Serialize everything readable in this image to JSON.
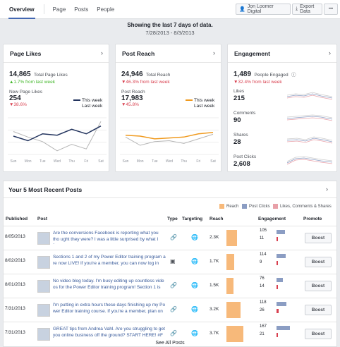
{
  "nav": {
    "tabs": [
      "Overview",
      "Page",
      "Posts",
      "People"
    ],
    "account": "Jon Loomer Digital",
    "export": "Export Data",
    "more": "•••"
  },
  "banner": {
    "line1": "Showing the last 7 days of data.",
    "line2": "7/28/2013 - 8/3/2013"
  },
  "page_likes": {
    "title": "Page Likes",
    "total": "14,865",
    "total_label": "Total Page Likes",
    "total_change": "▲1.7% from last week",
    "new_label": "New Page Likes",
    "new_value": "254",
    "new_change": "▼38.6%",
    "legend_this": "This week",
    "legend_last": "Last week",
    "days": [
      "Sun",
      "Mon",
      "Tue",
      "Wed",
      "Thu",
      "Fri",
      "Sat"
    ],
    "this_week": [
      40,
      30,
      45,
      42,
      55,
      45,
      62
    ],
    "last_week": [
      50,
      38,
      28,
      8,
      22,
      12,
      72
    ]
  },
  "post_reach": {
    "title": "Post Reach",
    "total": "24,946",
    "total_label": "Total Reach",
    "total_change": "▼46.3% from last week",
    "sub_label": "Post Reach",
    "sub_value": "17,983",
    "sub_change": "▼45.8%",
    "legend_this": "This week",
    "legend_last": "Last week",
    "days": [
      "Sun",
      "Mon",
      "Tue",
      "Wed",
      "Thu",
      "Fri",
      "Sat"
    ],
    "this_week": [
      42,
      40,
      34,
      36,
      38,
      45,
      48
    ],
    "last_week": [
      38,
      20,
      28,
      30,
      24,
      34,
      44
    ]
  },
  "engagement": {
    "title": "Engagement",
    "total": "1,489",
    "total_label": "People Engaged",
    "total_change": "▼32.4% from last week",
    "rows": [
      {
        "label": "Likes",
        "value": "215"
      },
      {
        "label": "Comments",
        "value": "90"
      },
      {
        "label": "Shares",
        "value": "28"
      },
      {
        "label": "Post Clicks",
        "value": "2,608"
      }
    ]
  },
  "posts": {
    "title": "Your 5 Most Recent Posts",
    "legend": [
      "Reach",
      "Post Clicks",
      "Likes, Comments & Shares"
    ],
    "headers": [
      "Published",
      "Post",
      "Type",
      "Targeting",
      "Reach",
      "Engagement",
      "Promote"
    ],
    "rows": [
      {
        "date": "8/05/2013",
        "text": "Are the conversions Facebook is reporting what you tho ught they were? I was a little surprised by what I foun",
        "reach": "2.3K",
        "reach_frac": 0.61,
        "clicks": "105",
        "lcs": "11",
        "clicks_frac": 0.65,
        "lcs_frac": 0.07,
        "type": "link"
      },
      {
        "date": "8/02/2013",
        "text": "Sections 1 and 2 of my Power Editor training program a re now LIVE! If you're a member, you can now log in",
        "reach": "1.7K",
        "reach_frac": 0.45,
        "clicks": "114",
        "lcs": "9",
        "clicks_frac": 0.7,
        "lcs_frac": 0.06,
        "type": "status"
      },
      {
        "date": "8/01/2013",
        "text": "No video blog today. I'm busy editing up countless vide os for the Power Editor training program! Section 1 is",
        "reach": "1.5K",
        "reach_frac": 0.4,
        "clicks": "76",
        "lcs": "14",
        "clicks_frac": 0.47,
        "lcs_frac": 0.09,
        "type": "link"
      },
      {
        "date": "7/31/2013",
        "text": "I'm putting in extra hours these days finishing up my Po wer Editor training course. If you're a member, plan on s",
        "reach": "3.2K",
        "reach_frac": 0.85,
        "clicks": "118",
        "lcs": "26",
        "clicks_frac": 0.73,
        "lcs_frac": 0.16,
        "type": "link"
      },
      {
        "date": "7/31/2013",
        "text": "GREAT tips from Andrea Vahl. Are you struggling to get you online business off the ground? START HERE! #F",
        "reach": "3.7K",
        "reach_frac": 0.98,
        "clicks": "167",
        "lcs": "21",
        "clicks_frac": 1.0,
        "lcs_frac": 0.13,
        "type": "link"
      }
    ],
    "boost": "Boost",
    "see_all": "See All Posts"
  },
  "colors": {
    "reach": "#f7b97a",
    "clicks": "#8b9dc3",
    "lcs": "#e8a0a8",
    "navy": "#23345e",
    "orange": "#f09a1e",
    "gray": "#b5b5b5"
  }
}
